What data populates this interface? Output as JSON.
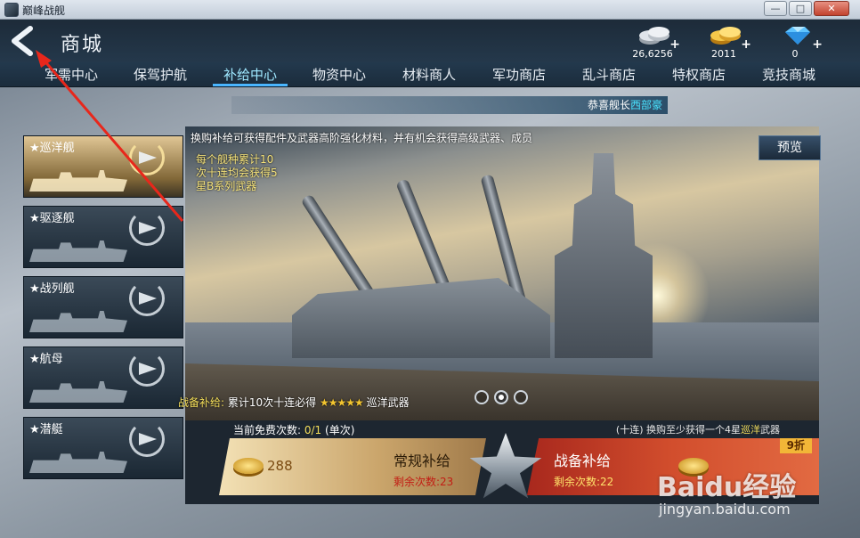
{
  "window": {
    "title": "巅峰战舰",
    "min": "—",
    "max": "□",
    "close": "✕"
  },
  "header": {
    "title": "商城"
  },
  "currencies": [
    {
      "name": "silver",
      "amount": "26,6256",
      "plus": "+"
    },
    {
      "name": "gold",
      "amount": "2011",
      "plus": "+"
    },
    {
      "name": "diamond",
      "amount": "0",
      "plus": "+"
    }
  ],
  "tabs": [
    {
      "label": "军需中心"
    },
    {
      "label": "保驾护航"
    },
    {
      "label": "补给中心"
    },
    {
      "label": "物资中心"
    },
    {
      "label": "材料商人"
    },
    {
      "label": "军功商店"
    },
    {
      "label": "乱斗商店"
    },
    {
      "label": "特权商店"
    },
    {
      "label": "竞技商城"
    }
  ],
  "active_tab": "补给中心",
  "ticker": {
    "prefix": "恭喜舰长",
    "name": "西部豪"
  },
  "ship_types": [
    {
      "label": "★巡洋舰"
    },
    {
      "label": "★驱逐舰"
    },
    {
      "label": "★战列舰"
    },
    {
      "label": "★航母"
    },
    {
      "label": "★潜艇"
    }
  ],
  "banner": {
    "description": "换购补给可获得配件及武器高阶强化材料，并有机会获得高级武器、成员",
    "note_lines": [
      "每个舰种累计10",
      "次十连均会获得5",
      "星B系列武器"
    ],
    "preview_label": "预览"
  },
  "guarantee": {
    "label": "战备补给:",
    "text": "累计10次十连必得",
    "stars": "★★★★★",
    "weapon": "巡洋武器"
  },
  "free_count": {
    "label": "当前免费次数:",
    "value": "0/1",
    "suffix": "(单次)"
  },
  "ten_pull": {
    "prefix": "(十连) 换购至少获得一个4星",
    "hl": "巡洋",
    "suffix": "武器"
  },
  "normal_supply": {
    "price": "288",
    "name": "常规补给",
    "remain": "剩余次数:23"
  },
  "war_supply": {
    "name": "战备补给",
    "remain": "剩余次数:22",
    "discount": "9折"
  },
  "watermark": {
    "text": "Baidu经验",
    "url": "jingyan.baidu.com"
  }
}
